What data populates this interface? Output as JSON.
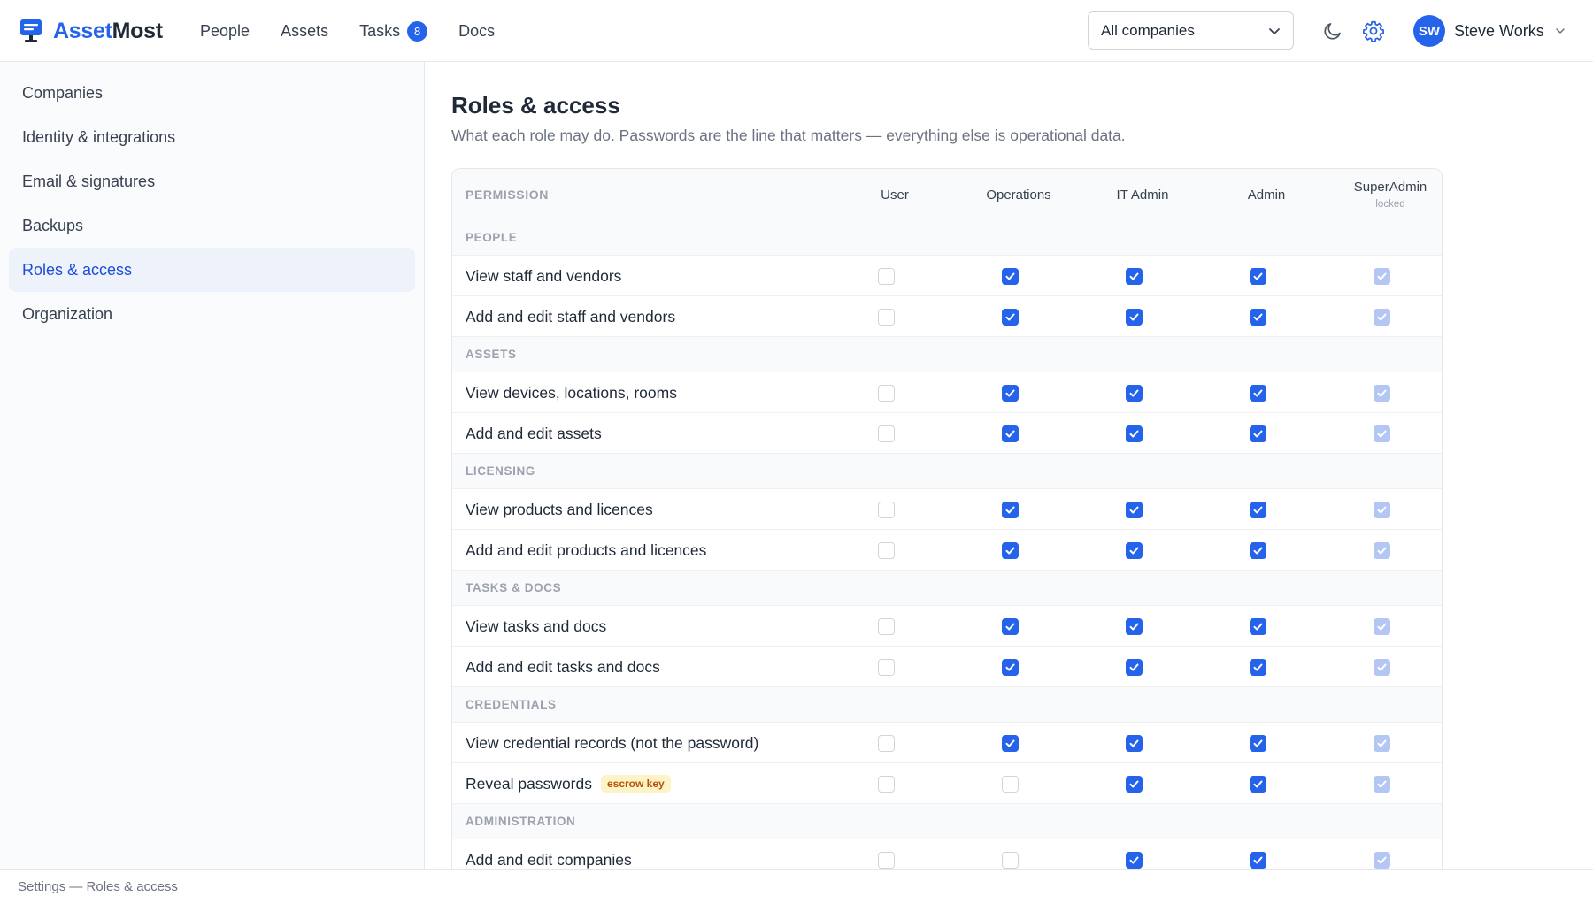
{
  "brand": {
    "part1": "Asset",
    "part2": "Most",
    "icon": "monitor-logo-icon",
    "accent": "#2563eb"
  },
  "nav": {
    "people": "People",
    "assets": "Assets",
    "tasks": "Tasks",
    "tasks_badge": "8",
    "docs": "Docs"
  },
  "company_select": {
    "value": "All companies"
  },
  "header_icons": {
    "theme": "moon-icon",
    "settings": "gear-icon"
  },
  "user": {
    "initials": "SW",
    "name": "Steve Works"
  },
  "sidebar": {
    "items": [
      {
        "label": "Companies"
      },
      {
        "label": "Identity & integrations"
      },
      {
        "label": "Email & signatures"
      },
      {
        "label": "Backups"
      },
      {
        "label": "Roles & access",
        "active": true
      },
      {
        "label": "Organization"
      }
    ]
  },
  "page": {
    "title": "Roles & access",
    "subtitle": "What each role may do. Passwords are the line that matters — everything else is operational data."
  },
  "table": {
    "permission_header": "PERMISSION",
    "roles": [
      {
        "name": "User",
        "note": ""
      },
      {
        "name": "Operations",
        "note": ""
      },
      {
        "name": "IT Admin",
        "note": ""
      },
      {
        "name": "Admin",
        "note": ""
      },
      {
        "name": "SuperAdmin",
        "note": "locked"
      }
    ],
    "sections": [
      {
        "title": "PEOPLE",
        "rows": [
          {
            "label": "View staff and vendors",
            "checks": [
              false,
              true,
              true,
              true,
              true
            ]
          },
          {
            "label": "Add and edit staff and vendors",
            "checks": [
              false,
              true,
              true,
              true,
              true
            ]
          }
        ]
      },
      {
        "title": "ASSETS",
        "rows": [
          {
            "label": "View devices, locations, rooms",
            "checks": [
              false,
              true,
              true,
              true,
              true
            ]
          },
          {
            "label": "Add and edit assets",
            "checks": [
              false,
              true,
              true,
              true,
              true
            ]
          }
        ]
      },
      {
        "title": "LICENSING",
        "rows": [
          {
            "label": "View products and licences",
            "checks": [
              false,
              true,
              true,
              true,
              true
            ]
          },
          {
            "label": "Add and edit products and licences",
            "checks": [
              false,
              true,
              true,
              true,
              true
            ]
          }
        ]
      },
      {
        "title": "TASKS & DOCS",
        "rows": [
          {
            "label": "View tasks and docs",
            "checks": [
              false,
              true,
              true,
              true,
              true
            ]
          },
          {
            "label": "Add and edit tasks and docs",
            "checks": [
              false,
              true,
              true,
              true,
              true
            ]
          }
        ]
      },
      {
        "title": "CREDENTIALS",
        "rows": [
          {
            "label": "View credential records (not the password)",
            "checks": [
              false,
              true,
              true,
              true,
              true
            ]
          },
          {
            "label": "Reveal passwords",
            "tag": "escrow key",
            "checks": [
              false,
              false,
              true,
              true,
              true
            ]
          }
        ]
      },
      {
        "title": "ADMINISTRATION",
        "rows": [
          {
            "label": "Add and edit companies",
            "checks": [
              false,
              false,
              true,
              true,
              true
            ]
          }
        ]
      }
    ]
  },
  "footer": {
    "breadcrumb": "Settings — Roles & access"
  }
}
